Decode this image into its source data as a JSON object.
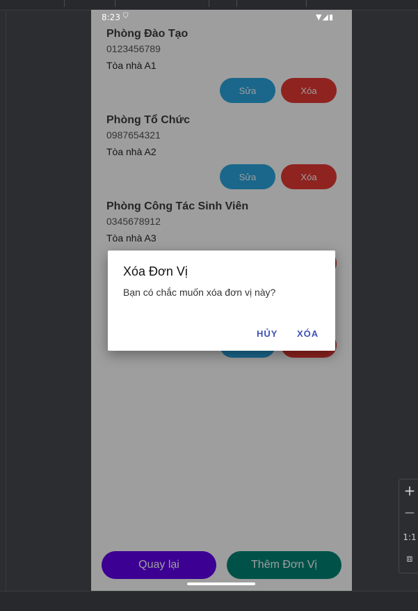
{
  "status_bar": {
    "time": "8:23",
    "shield_icon": "shield-icon",
    "right_icons": "wifi-icon signal-icon battery-icon"
  },
  "units": [
    {
      "name": "Phòng Đào Tạo",
      "phone": "0123456789",
      "building": "Tòa nhà A1"
    },
    {
      "name": "Phòng Tổ Chức",
      "phone": "0987654321",
      "building": "Tòa nhà A2"
    },
    {
      "name": "Phòng Công Tác Sinh Viên",
      "phone": "0345678912",
      "building": "Tòa nhà A3"
    }
  ],
  "item_buttons": {
    "edit": "Sửa",
    "delete": "Xóa"
  },
  "bottom_buttons": {
    "back": "Quay lại",
    "add": "Thêm Đơn Vị"
  },
  "dialog": {
    "title": "Xóa Đơn Vị",
    "message": "Bạn có chắc muốn xóa đơn vị này?",
    "cancel": "HỦY",
    "confirm": "XÓA"
  },
  "zoom_panel": {
    "plus": "+",
    "minus": "—",
    "ratio": "1:1"
  },
  "colors": {
    "edit": "#2aa7e0",
    "delete": "#e53935",
    "back": "#6200ee",
    "add": "#018577",
    "dialog_action": "#3f51b5"
  }
}
